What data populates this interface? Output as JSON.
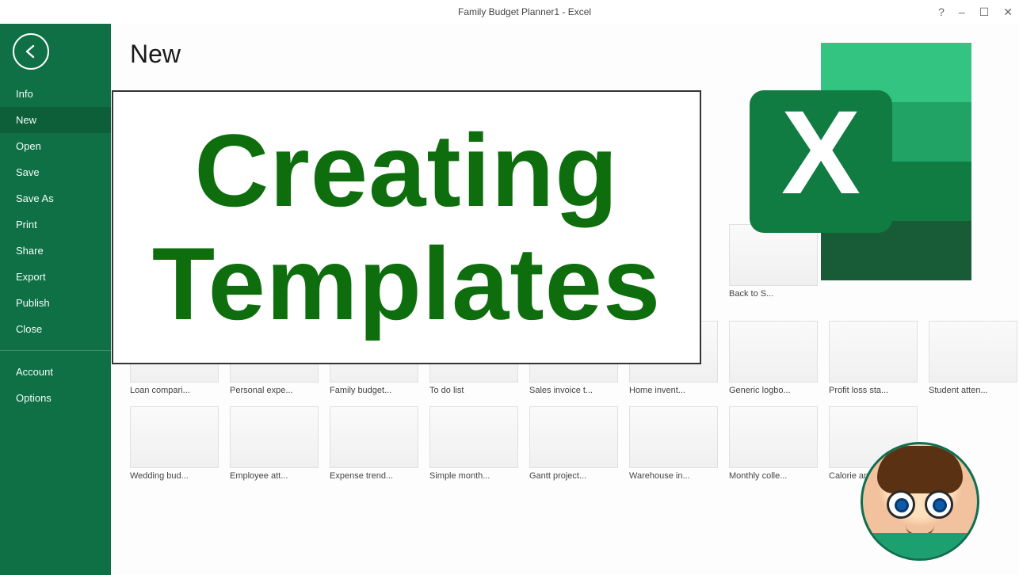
{
  "titlebar": {
    "title": "Family Budget Planner1 - Excel",
    "help": "?",
    "minimize": "–",
    "maximize": "☐",
    "close": "✕"
  },
  "sidebar": {
    "items": [
      {
        "label": "Info"
      },
      {
        "label": "New"
      },
      {
        "label": "Open"
      },
      {
        "label": "Save"
      },
      {
        "label": "Save As"
      },
      {
        "label": "Print"
      },
      {
        "label": "Share"
      },
      {
        "label": "Export"
      },
      {
        "label": "Publish"
      },
      {
        "label": "Close"
      }
    ],
    "bottom": [
      {
        "label": "Account"
      },
      {
        "label": "Options"
      }
    ]
  },
  "main": {
    "page_title": "New"
  },
  "templates_upper": [
    {
      "label": "Back to S..."
    }
  ],
  "templates_row1": [
    {
      "label": "Loan compari..."
    },
    {
      "label": "Personal expe..."
    },
    {
      "label": "Family budget..."
    },
    {
      "label": "To do list"
    },
    {
      "label": "Sales invoice t..."
    },
    {
      "label": "Home invent..."
    },
    {
      "label": "Generic logbo..."
    },
    {
      "label": "Profit loss sta..."
    },
    {
      "label": "Student atten..."
    }
  ],
  "templates_row2": [
    {
      "label": "Wedding bud..."
    },
    {
      "label": "Employee att..."
    },
    {
      "label": "Expense trend..."
    },
    {
      "label": "Simple month..."
    },
    {
      "label": "Gantt project..."
    },
    {
      "label": "Warehouse in..."
    },
    {
      "label": "Monthly colle..."
    },
    {
      "label": "Calorie amort..."
    }
  ],
  "overlay": {
    "line1": "Creating",
    "line2": "Templates"
  },
  "colors": {
    "sidebar": "#0e7044",
    "overlay_text": "#0e6e0e"
  }
}
